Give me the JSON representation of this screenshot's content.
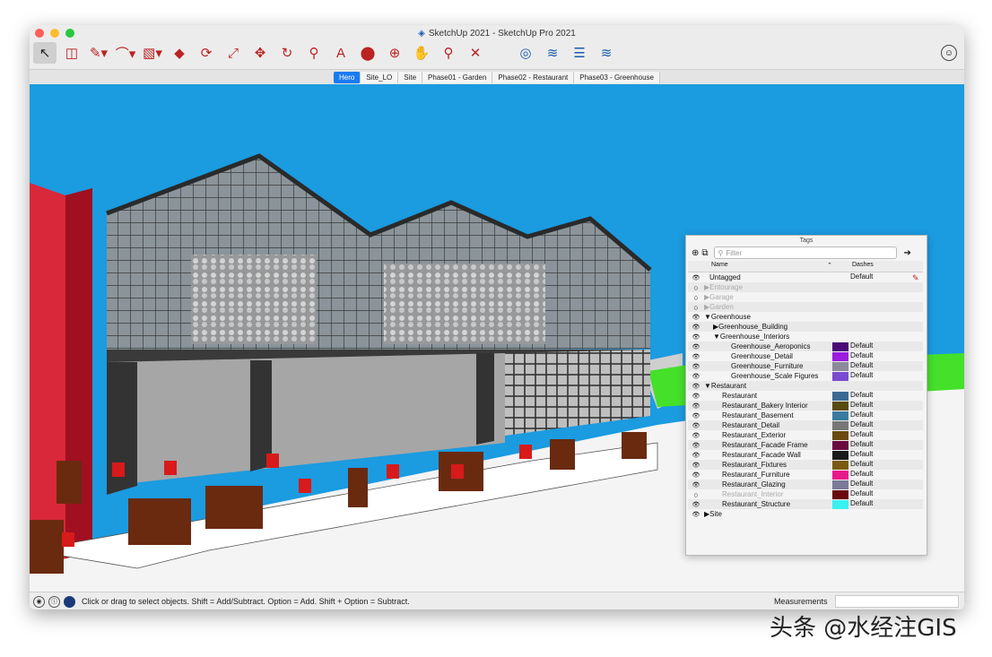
{
  "window": {
    "title": "SketchUp 2021 - SketchUp Pro 2021"
  },
  "toolbar": {
    "tools": [
      {
        "icon": "select-arrow-icon",
        "glyph": "↖"
      },
      {
        "icon": "eraser-icon",
        "glyph": "◫"
      },
      {
        "icon": "pencil-icon",
        "glyph": "✎▾"
      },
      {
        "icon": "arc-icon",
        "glyph": "⌒▾"
      },
      {
        "icon": "rectangle-icon",
        "glyph": "▧▾"
      },
      {
        "icon": "push-pull-icon",
        "glyph": "◆"
      },
      {
        "icon": "offset-icon",
        "glyph": "⟳"
      },
      {
        "icon": "scale-icon",
        "glyph": "⤢"
      },
      {
        "icon": "move-icon",
        "glyph": "✥"
      },
      {
        "icon": "rotate-icon",
        "glyph": "↻"
      },
      {
        "icon": "tape-measure-icon",
        "glyph": "⚲"
      },
      {
        "icon": "text-icon",
        "glyph": "A"
      },
      {
        "icon": "paint-bucket-icon",
        "glyph": "⬤"
      },
      {
        "icon": "orbit-icon",
        "glyph": "⊕"
      },
      {
        "icon": "pan-icon",
        "glyph": "✋"
      },
      {
        "icon": "zoom-icon",
        "glyph": "⚲"
      },
      {
        "icon": "zoom-extents-icon",
        "glyph": "✕"
      },
      {
        "icon": "warehouse-icon",
        "glyph": "◎"
      },
      {
        "icon": "extension-warehouse-icon",
        "glyph": "≋"
      },
      {
        "icon": "layers-icon",
        "glyph": "☰"
      },
      {
        "icon": "extension-manager-icon",
        "glyph": "≋"
      }
    ]
  },
  "scenes": [
    "Hero",
    "Site_LO",
    "Site",
    "Phase01 - Garden",
    "Phase02 - Restaurant",
    "Phase03 - Greenhouse"
  ],
  "tags_panel": {
    "title": "Tags",
    "filter_placeholder": "Filter",
    "col_name": "Name",
    "col_dashes": "Dashes",
    "rows": [
      {
        "name": "Untagged",
        "indent": 0,
        "vis": "eye",
        "arrow": "",
        "color": "",
        "dashes": "Default",
        "grayed": false
      },
      {
        "name": "Entourage",
        "indent": 0,
        "vis": "hidden",
        "arrow": "▶",
        "color": "",
        "dashes": "",
        "grayed": true
      },
      {
        "name": "Garage",
        "indent": 0,
        "vis": "hidden",
        "arrow": "▶",
        "color": "",
        "dashes": "",
        "grayed": true
      },
      {
        "name": "Garden",
        "indent": 0,
        "vis": "hidden",
        "arrow": "▶",
        "color": "",
        "dashes": "",
        "grayed": true
      },
      {
        "name": "Greenhouse",
        "indent": 0,
        "vis": "eye",
        "arrow": "▼",
        "color": "",
        "dashes": "",
        "grayed": false
      },
      {
        "name": "Greenhouse_Building",
        "indent": 1,
        "vis": "eye",
        "arrow": "▶",
        "color": "",
        "dashes": "",
        "grayed": false
      },
      {
        "name": "Greenhouse_Interiors",
        "indent": 1,
        "vis": "eye",
        "arrow": "▼",
        "color": "",
        "dashes": "",
        "grayed": false
      },
      {
        "name": "Greenhouse_Aeroponics",
        "indent": 2,
        "vis": "eye",
        "arrow": "",
        "color": "#4a0a78",
        "dashes": "Default",
        "grayed": false
      },
      {
        "name": "Greenhouse_Detail",
        "indent": 2,
        "vis": "eye",
        "arrow": "",
        "color": "#9b1de0",
        "dashes": "Default",
        "grayed": false
      },
      {
        "name": "Greenhouse_Furniture",
        "indent": 2,
        "vis": "eye",
        "arrow": "",
        "color": "#8a8a9a",
        "dashes": "Default",
        "grayed": false
      },
      {
        "name": "Greenhouse_Scale Figures",
        "indent": 2,
        "vis": "eye",
        "arrow": "",
        "color": "#7a4ad0",
        "dashes": "Default",
        "grayed": false
      },
      {
        "name": "Restaurant",
        "indent": 0,
        "vis": "eye",
        "arrow": "▼",
        "color": "",
        "dashes": "",
        "grayed": false
      },
      {
        "name": "Restaurant",
        "indent": 1,
        "vis": "eye",
        "arrow": "",
        "color": "#3a6a94",
        "dashes": "Default",
        "grayed": false
      },
      {
        "name": "Restaurant_Bakery Interior",
        "indent": 1,
        "vis": "eye",
        "arrow": "",
        "color": "#5a4a10",
        "dashes": "Default",
        "grayed": false
      },
      {
        "name": "Restaurant_Basement",
        "indent": 1,
        "vis": "eye",
        "arrow": "",
        "color": "#3a7aa0",
        "dashes": "Default",
        "grayed": false
      },
      {
        "name": "Restaurant_Detail",
        "indent": 1,
        "vis": "eye",
        "arrow": "",
        "color": "#777777",
        "dashes": "Default",
        "grayed": false
      },
      {
        "name": "Restaurant_Exterior",
        "indent": 1,
        "vis": "eye",
        "arrow": "",
        "color": "#6a4a10",
        "dashes": "Default",
        "grayed": false
      },
      {
        "name": "Restaurant_Facade Frame",
        "indent": 1,
        "vis": "eye",
        "arrow": "",
        "color": "#6a0a40",
        "dashes": "Default",
        "grayed": false
      },
      {
        "name": "Restaurant_Facade Wall",
        "indent": 1,
        "vis": "eye",
        "arrow": "",
        "color": "#1a1a1a",
        "dashes": "Default",
        "grayed": false
      },
      {
        "name": "Restaurant_Fixtures",
        "indent": 1,
        "vis": "eye",
        "arrow": "",
        "color": "#7a5a10",
        "dashes": "Default",
        "grayed": false
      },
      {
        "name": "Restaurant_Furniture",
        "indent": 1,
        "vis": "eye",
        "arrow": "",
        "color": "#e81a8a",
        "dashes": "Default",
        "grayed": false
      },
      {
        "name": "Restaurant_Glazing",
        "indent": 1,
        "vis": "eye",
        "arrow": "",
        "color": "#7a7a9a",
        "dashes": "Default",
        "grayed": false
      },
      {
        "name": "Restaurant_Interior",
        "indent": 1,
        "vis": "hidden",
        "arrow": "",
        "color": "#6a0a10",
        "dashes": "Default",
        "grayed": true
      },
      {
        "name": "Restaurant_Structure",
        "indent": 1,
        "vis": "eye",
        "arrow": "",
        "color": "#3af0f0",
        "dashes": "Default",
        "grayed": false
      },
      {
        "name": "Site",
        "indent": 0,
        "vis": "eye",
        "arrow": "▶",
        "color": "",
        "dashes": "",
        "grayed": false
      }
    ]
  },
  "status": {
    "message": "Click or drag to select objects. Shift = Add/Subtract. Option = Add. Shift + Option = Subtract.",
    "measurements_label": "Measurements",
    "measurements_value": ""
  },
  "watermark": "头条 @水经注GIS",
  "colors": {
    "sky": "#1b9be0",
    "red_building": "#d8283a",
    "grass": "#44e02a",
    "chair": "#d81a1a",
    "planter": "#6a2a10"
  }
}
